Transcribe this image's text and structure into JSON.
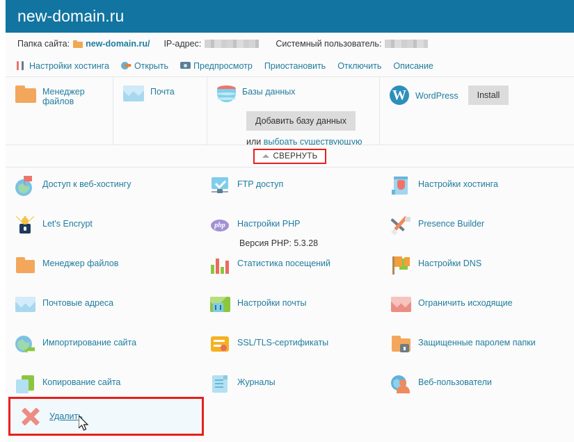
{
  "header": {
    "domain_title": "new-domain.ru"
  },
  "info_bar": {
    "site_folder_label": "Папка сайта:",
    "site_folder_value": "new-domain.ru/",
    "ip_label": "IP-адрес:",
    "ip_value": "",
    "sys_user_label": "Системный пользователь:",
    "sys_user_value": ""
  },
  "toolbar": {
    "items": [
      {
        "label": "Настройки хостинга",
        "icon": "fork-knife-icon"
      },
      {
        "label": "Открыть",
        "icon": "open-arrow-icon"
      },
      {
        "label": "Предпросмотр",
        "icon": "preview-monitor-icon"
      },
      {
        "label": "Приостановить",
        "icon": ""
      },
      {
        "label": "Отключить",
        "icon": ""
      },
      {
        "label": "Описание",
        "icon": ""
      }
    ]
  },
  "tiles": {
    "file_manager": {
      "label": "Менеджер файлов",
      "icon": "folder-icon"
    },
    "mail": {
      "label": "Почта",
      "icon": "envelope-icon"
    },
    "databases": {
      "label": "Базы данных",
      "icon": "database-icon",
      "add_button": "Добавить базу данных",
      "or_text": "или",
      "choose_existing": "выбрать существующую"
    },
    "wordpress": {
      "label": "WordPress",
      "icon": "wordpress-icon",
      "install_button": "Install"
    }
  },
  "collapse": {
    "label": "СВЕРНУТЬ",
    "icon": "chevron-up-icon"
  },
  "grid": {
    "rows": [
      [
        {
          "label": "Доступ к веб-хостингу",
          "icon": "globe-flag-icon",
          "sub": ""
        },
        {
          "label": "FTP доступ",
          "icon": "ftp-folder-icon",
          "sub": ""
        },
        {
          "label": "Настройки хостинга",
          "icon": "hosting-shield-icon",
          "sub": ""
        }
      ],
      [
        {
          "label": "Let's Encrypt",
          "icon": "lets-encrypt-lock-icon",
          "sub": ""
        },
        {
          "label": "Настройки PHP",
          "icon": "php-icon",
          "sub": "Версия PHP: 5.3.28"
        },
        {
          "label": "Presence Builder",
          "icon": "pencil-hammer-icon",
          "sub": ""
        }
      ],
      [
        {
          "label": "Менеджер файлов",
          "icon": "folder-icon",
          "sub": ""
        },
        {
          "label": "Статистика посещений",
          "icon": "bar-chart-icon",
          "sub": ""
        },
        {
          "label": "Настройки DNS",
          "icon": "dns-flags-icon",
          "sub": ""
        }
      ],
      [
        {
          "label": "Почтовые адреса",
          "icon": "blue-envelope-icon",
          "sub": ""
        },
        {
          "label": "Настройки почты",
          "icon": "green-envelope-icon",
          "sub": ""
        },
        {
          "label": "Ограничить исходящие",
          "icon": "red-envelope-icon",
          "sub": ""
        }
      ],
      [
        {
          "label": "Импортирование сайта",
          "icon": "site-import-icon",
          "sub": ""
        },
        {
          "label": "SSL/TLS-сертификаты",
          "icon": "ssl-certificate-icon",
          "sub": ""
        },
        {
          "label": "Защищенные паролем папки",
          "icon": "folder-lock-icon",
          "sub": ""
        }
      ],
      [
        {
          "label": "Копирование сайта",
          "icon": "site-copy-icon",
          "sub": ""
        },
        {
          "label": "Журналы",
          "icon": "logs-document-icon",
          "sub": ""
        },
        {
          "label": "Веб-пользователи",
          "icon": "web-users-icon",
          "sub": ""
        }
      ]
    ]
  },
  "delete": {
    "label": "Удалить",
    "icon": "red-x-icon"
  },
  "colors": {
    "banner_blue": "#1274a0",
    "link_blue": "#1f7c9e",
    "highlight_red": "#e8201a",
    "panel_bg": "#fbfbfb",
    "button_grey": "#dcdcdc"
  }
}
